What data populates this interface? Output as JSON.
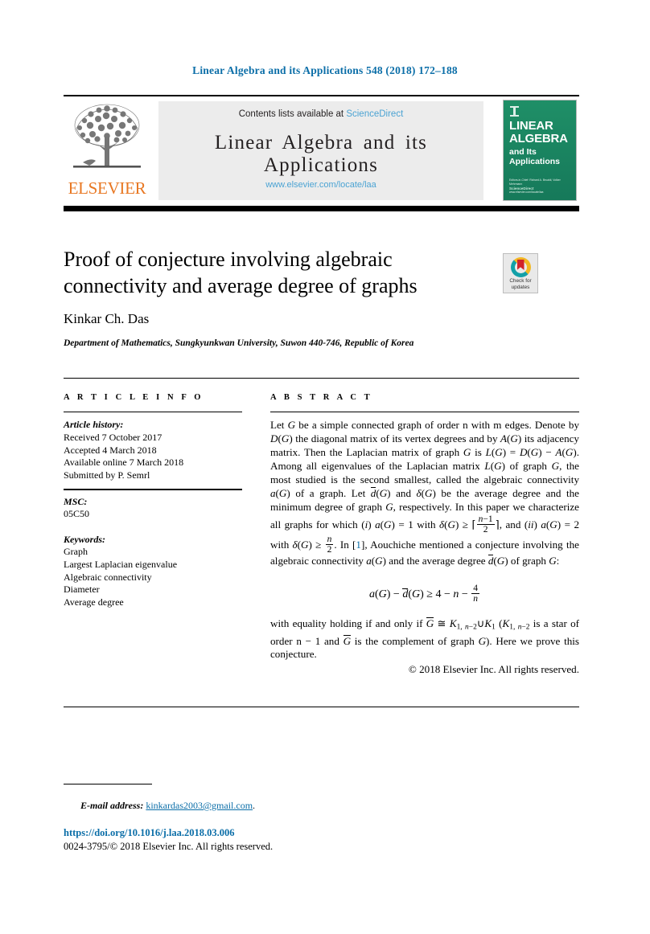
{
  "running_head": "Linear Algebra and its Applications 548 (2018) 172–188",
  "masthead": {
    "contents_prefix": "Contents lists available at ",
    "sciencedirect": "ScienceDirect",
    "journal_title": "Linear Algebra and its Applications",
    "journal_url": "www.elsevier.com/locate/laa",
    "publisher_wordmark": "ELSEVIER",
    "cover": {
      "line1": "LINEAR",
      "line2": "ALGEBRA",
      "line3": "and Its Applications",
      "foot_small": "Editors-in-Chief: Richard A. Brualdi, Volker Mehrmann",
      "foot_brand": "ScienceDirect",
      "foot_url": "www.elsevier.com/locate/laa"
    }
  },
  "article": {
    "title": "Proof of conjecture involving algebraic connectivity and average degree of graphs",
    "author": "Kinkar Ch. Das",
    "affiliation": "Department of Mathematics, Sungkyunkwan University, Suwon 440-746, Republic of Korea",
    "crossmark": {
      "line1": "Check for",
      "line2": "updates"
    }
  },
  "info": {
    "heading": "A R T I C L E   I N F O",
    "history_label": "Article history:",
    "history": [
      "Received 7 October 2017",
      "Accepted 4 March 2018",
      "Available online 7 March 2018",
      "Submitted by P. Semrl"
    ],
    "msc_label": "MSC:",
    "msc": "05C50",
    "keywords_label": "Keywords:",
    "keywords": [
      "Graph",
      "Largest Laplacian eigenvalue",
      "Algebraic connectivity",
      "Diameter",
      "Average degree"
    ]
  },
  "abstract": {
    "heading": "A B S T R A C T",
    "p1_a": "Let ",
    "p1_b": " be a simple connected graph of order n with m edges. Denote by ",
    "p1_c": " the diagonal matrix of its vertex degrees and by ",
    "p1_d": " its adjacency matrix. Then the Laplacian matrix of graph ",
    "p1_e": " is ",
    "p1_f": ". Among all eigenvalues of the Laplacian matrix ",
    "p1_g": " of graph ",
    "p1_h": ", the most studied is the second smallest, called the algebraic connectivity ",
    "p1_i": " of a graph. Let ",
    "p1_j": " and ",
    "p1_k": " be the average degree and the minimum degree of graph ",
    "p1_l": ", respectively. In this paper we characterize all graphs for which ",
    "p1_m": " with ",
    "p1_n": ", and ",
    "p1_o": ". In ",
    "ref": "1",
    "p1_p": ", Aouchiche mentioned a conjecture involving the algebraic connectivity ",
    "p1_q": " and the average degree ",
    "p1_r": " of graph ",
    "p1_s": ":",
    "equation_plain": "a(G) − d̄(G) ≥ 4 − n − 4/n",
    "p2_a": "with equality holding if and only if ",
    "p2_b": " is a star of order n − 1 and ",
    "p2_c": " is the complement of graph ",
    "p2_d": "Here we prove this conjecture.",
    "copyright": "© 2018 Elsevier Inc. All rights reserved."
  },
  "footer": {
    "email_label": "E-mail address:",
    "email": "kinkardas2003@gmail.com",
    "email_period": ".",
    "doi": "https://doi.org/10.1016/j.laa.2018.03.006",
    "issn_line": "0024-3795/© 2018 Elsevier Inc. All rights reserved."
  },
  "colors": {
    "link_blue": "#0b6ea8",
    "light_blue": "#4ba3d3",
    "elsevier_orange": "#e87722",
    "cover_green": "#1e8a63",
    "crossmark_red": "#d2232a"
  }
}
